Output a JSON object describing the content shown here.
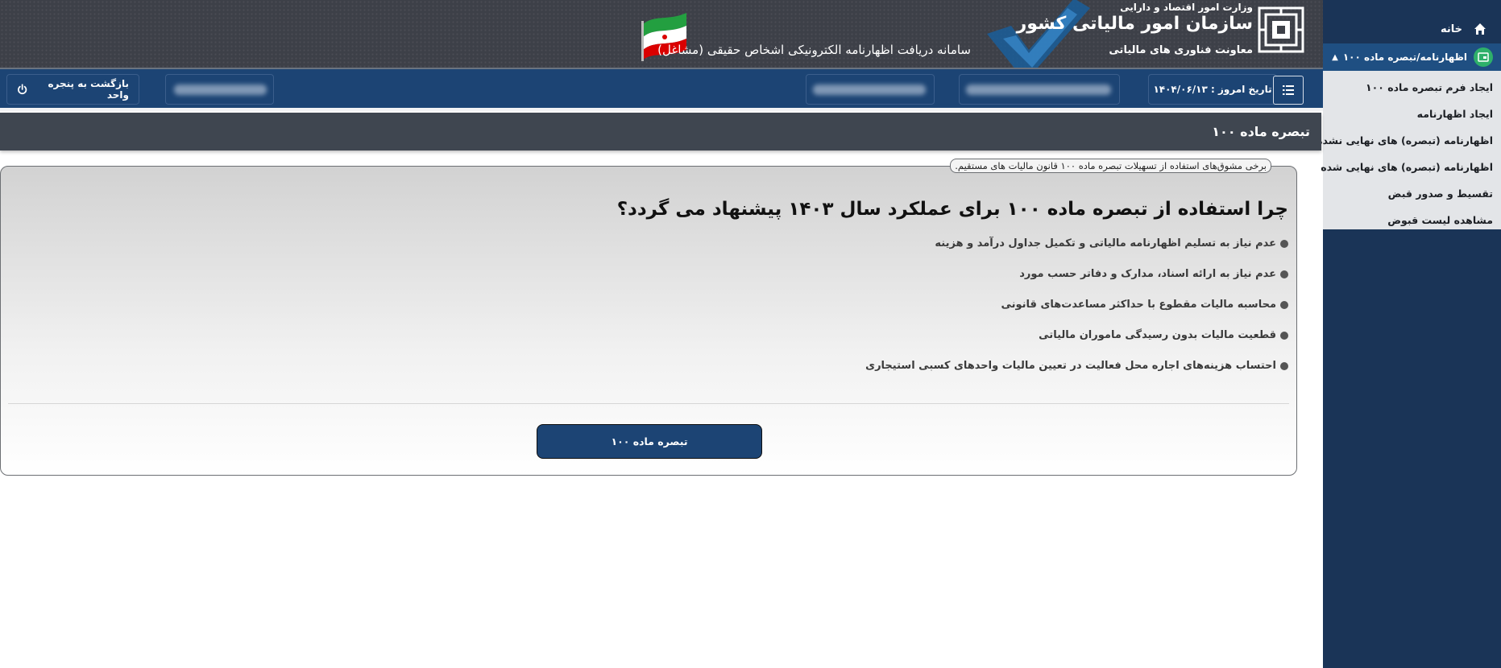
{
  "header": {
    "ministry": "وزارت امور اقتصاد و دارایی",
    "organization": "سازمان امور مالیاتی کشور",
    "deputy": "معاونت فناوری های مالیاتی",
    "system_title": "سامانه دریافت اظهارنامه الکترونیکی اشخاص حقیقی (مشاغل)"
  },
  "sidebar": {
    "home_label": "خانه",
    "group_label": "اظهارنامه/تبصره ماده ۱۰۰",
    "items": [
      {
        "label": "ایجاد فرم تبصره ماده ۱۰۰"
      },
      {
        "label": "ایجاد اظهارنامه"
      },
      {
        "label": "اظهارنامه (تبصره) های نهایی نشده"
      },
      {
        "label": "اظهارنامه (تبصره) های نهایی شده"
      },
      {
        "label": "تقسیط و صدور قبض"
      },
      {
        "label": "مشاهده لیست قبوض"
      }
    ]
  },
  "toolbar": {
    "back_label": "بازگشت به پنجره واحد",
    "date_label": "تاریخ امروز : ۱۴۰۴/۰۶/۱۳"
  },
  "page": {
    "title": "تبصره ماده ۱۰۰"
  },
  "card": {
    "legend": "برخی مشوق‌های استفاده از تسهیلات تبصره ماده ۱۰۰ قانون مالیات های مستقیم.",
    "question": "چرا استفاده از تبصره ماده ۱۰۰ برای عملکرد سال ۱۴۰۳ پیشنهاد می گردد؟",
    "benefits": [
      "عدم نیاز به تسلیم اظهارنامه مالیاتی و تکمیل جداول درآمد و هزینه",
      "عدم نیاز به ارائه اسناد، مدارک و دفاتر حسب مورد",
      "محاسبه مالیات مقطوع با حداکثر مساعدت‌های قانونی",
      "قطعیت مالیات بدون رسیدگی ماموران مالیاتی",
      "احتساب هزینه‌های اجاره محل فعالیت در تعیین مالیات واحدهای کسبی استیجاری"
    ],
    "button_label": "تبصره ماده ۱۰۰"
  },
  "colors": {
    "sidebar_bg": "#1a3457",
    "toolbar_bg": "#1c4474",
    "active_group_bg": "#1f4f82",
    "group_icon_green": "#2eb06a",
    "title_bar_bg": "#3f4650"
  },
  "icons": {
    "home": "home-icon",
    "group": "card-icon",
    "power": "power-icon",
    "menu": "list-menu-icon"
  }
}
